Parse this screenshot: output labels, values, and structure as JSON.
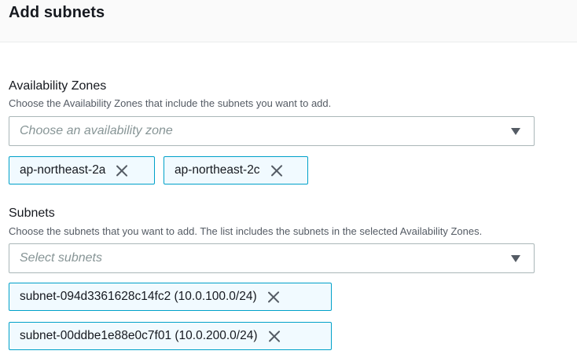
{
  "header": {
    "title": "Add subnets"
  },
  "availability_zones": {
    "label": "Availability Zones",
    "description": "Choose the Availability Zones that include the subnets you want to add.",
    "placeholder": "Choose an availability zone",
    "selected": [
      {
        "label": "ap-northeast-2a"
      },
      {
        "label": "ap-northeast-2c"
      }
    ]
  },
  "subnets": {
    "label": "Subnets",
    "description": "Choose the subnets that you want to add. The list includes the subnets in the selected Availability Zones.",
    "placeholder": "Select subnets",
    "selected": [
      {
        "label": "subnet-094d3361628c14fc2 (10.0.100.0/24)"
      },
      {
        "label": "subnet-00ddbe1e88e0c7f01 (10.0.200.0/24)"
      }
    ]
  },
  "icons": {
    "remove": "close-icon",
    "dropdown": "caret-down-icon"
  },
  "colors": {
    "token_border": "#00a1c9",
    "token_background": "#f1faff",
    "header_background": "#fafafa"
  }
}
